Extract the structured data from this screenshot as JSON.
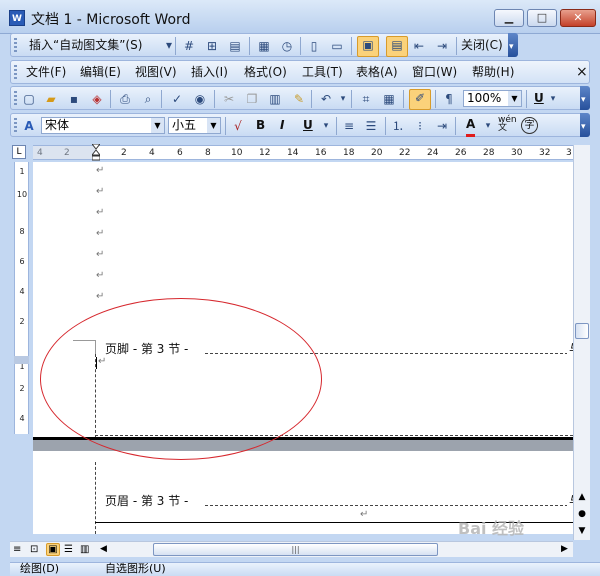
{
  "window": {
    "app_icon_text": "W",
    "title": "文档 1 - Microsoft Word",
    "controls": {
      "minimize": "▁",
      "maximize": "□",
      "close": "✕"
    }
  },
  "header_footer_toolbar": {
    "insert_autotext": "插入“自动图文集”(S)",
    "close": "关闭(C)"
  },
  "menu": {
    "items": [
      "文件(F)",
      "编辑(E)",
      "视图(V)",
      "插入(I)",
      "格式(O)",
      "工具(T)",
      "表格(A)",
      "窗口(W)",
      "帮助(H)"
    ],
    "close_doc": "×"
  },
  "standard_toolbar": {
    "zoom_value": "100%",
    "underline_label": "U"
  },
  "formatting_toolbar": {
    "font_name": "宋体",
    "font_size": "小五",
    "bold": "B",
    "italic": "I",
    "underline": "U",
    "font_color": "A",
    "phonetic_guide": "wén\n文",
    "enclose": "字"
  },
  "ruler": {
    "corner_marker": "L",
    "horizontal_ticks": [
      "4",
      "2",
      "2",
      "4",
      "6",
      "8",
      "10",
      "12",
      "14",
      "16",
      "18",
      "20",
      "22",
      "24",
      "26",
      "28",
      "30",
      "32",
      "3"
    ],
    "vertical_ticks": [
      "1",
      "10",
      "8",
      "6",
      "4",
      "2",
      "1",
      "2",
      "4"
    ]
  },
  "document": {
    "paragraph_mark": "↵",
    "footer_label": "页脚 - 第 3 节 -",
    "header_label": "页眉 - 第 3 节 -",
    "same_as_previous": "与"
  },
  "watermark": "Bai 经验",
  "draw_bar": {
    "draw_label": "绘图(D)",
    "autoshapes_label": "自选图形(U)"
  },
  "colors": {
    "annotation_circle": "#d6282e",
    "highlight": "#fbd27a",
    "toolbar_end": "#27509b"
  }
}
